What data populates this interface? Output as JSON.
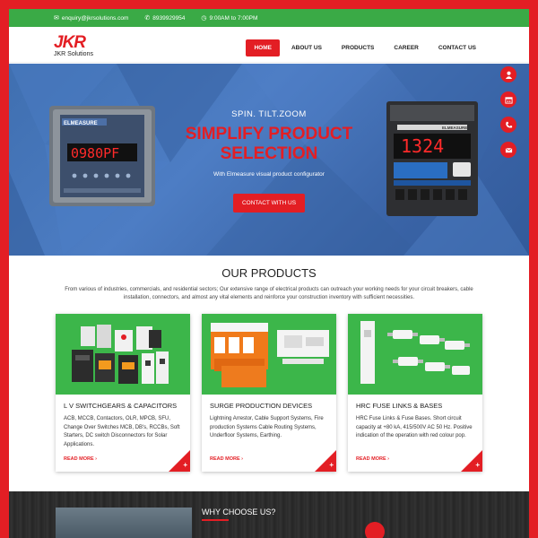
{
  "topbar": {
    "email": "enquiry@jkrsolutions.com",
    "phone": "8939929954",
    "hours": "9:00AM to 7:00PM"
  },
  "brand": {
    "logo_mark": "JKR",
    "logo_sub": "JKR Solutions",
    "accent": "#e31e24",
    "green": "#3aaa46"
  },
  "nav": [
    "HOME",
    "ABOUT US",
    "PRODUCTS",
    "CAREER",
    "CONTACT US"
  ],
  "nav_active": "HOME",
  "hero": {
    "subtitle": "SPIN. TILT.ZOOM",
    "title_line1": "SIMPLIFY PRODUCT",
    "title_line2": "SELECTION",
    "description": "With Elmeasure visual product configurator",
    "button": "CONTACT WITH US",
    "meter_left_brand": "ELMEASURE",
    "meter_left_display": "0980PF",
    "meter_right_brand": "ELMEASURE",
    "meter_right_display": "1324"
  },
  "side_icons": [
    "user-icon",
    "calendar-icon",
    "phone-icon",
    "mail-icon"
  ],
  "products": {
    "heading": "OUR PRODUCTS",
    "intro": "From various of industries, commercials, and residential sectors; Our extensive range of electrical products can outreach your working needs for your circuit breakers, cable installation, connectors, and almost any vital elements and reinforce your construction inventory with sufficient necessities.",
    "cards": [
      {
        "title": "L V SWITCHGEARS & CAPACITORS",
        "desc": "ACB, MCCB, Contactors, OLR, MPCB, SFU, Change Over Switches MCB, DB's, RCCBs, Soft Starters, DC switch Disconnectors for Solar Applications.",
        "more": "READ MORE"
      },
      {
        "title": "SURGE PRODUCTION DEVICES",
        "desc": "Lightning Arrestor, Cable Support Systems, Fire production Systems Cable Routing Systems, Underfloor Systems, Earthing.",
        "more": "READ MORE"
      },
      {
        "title": "HRC FUSE LINKS & BASES",
        "desc": "HRC Fuse Links & Fuse Bases. Short circuit capacity at +80 kA, 415/500V AC 50 Hz. Positive indication of the operation with red colour pop.",
        "more": "READ MORE"
      }
    ]
  },
  "why": {
    "title": "WHY CHOOSE US?"
  }
}
